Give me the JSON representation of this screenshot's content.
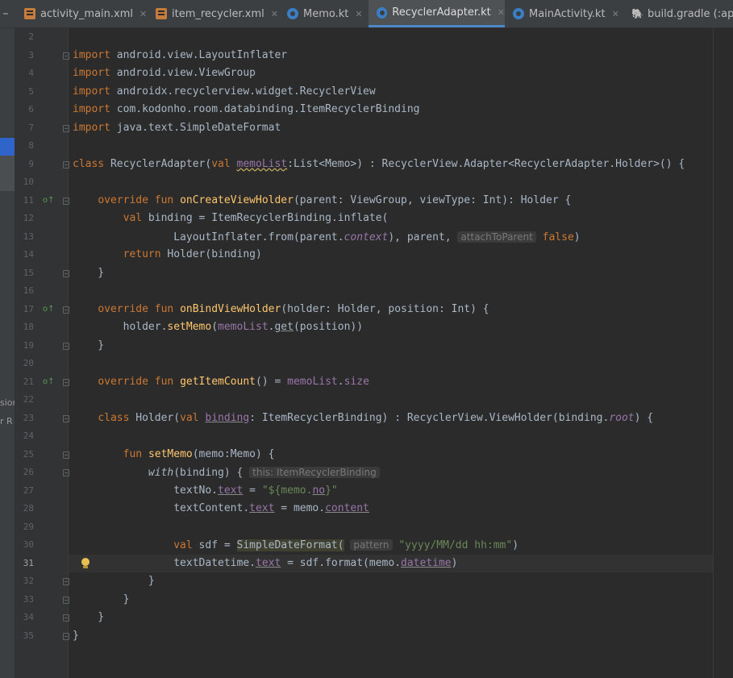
{
  "tabs": [
    {
      "label": "activity_main.xml",
      "icon": "xml-file-icon",
      "active": false
    },
    {
      "label": "item_recycler.xml",
      "icon": "xml-file-icon",
      "active": false
    },
    {
      "label": "Memo.kt",
      "icon": "kotlin-file-icon",
      "active": false
    },
    {
      "label": "RecyclerAdapter.kt",
      "icon": "kotlin-file-icon",
      "active": true
    },
    {
      "label": "MainActivity.kt",
      "icon": "kotlin-file-icon",
      "active": false
    },
    {
      "label": "build.gradle (:app",
      "icon": "gradle-file-icon",
      "active": false
    }
  ],
  "left_panel_fragments": [
    "sior",
    "r R"
  ],
  "colors": {
    "background": "#2b2b2b",
    "gutter": "#313335",
    "keyword": "#cc7832",
    "function": "#ffc66d",
    "string": "#6a8759",
    "property": "#9876aa",
    "text": "#a9b7c6",
    "accent": "#4a88c7"
  },
  "editor": {
    "current_line": 31,
    "lines": [
      {
        "n": "2",
        "t": ""
      },
      {
        "n": "3",
        "t": "import android.view.LayoutInflater"
      },
      {
        "n": "4",
        "t": "import android.view.ViewGroup"
      },
      {
        "n": "5",
        "t": "import androidx.recyclerview.widget.RecyclerView"
      },
      {
        "n": "6",
        "t": "import com.kodonho.room.databinding.ItemRecyclerBinding"
      },
      {
        "n": "7",
        "t": "import java.text.SimpleDateFormat"
      },
      {
        "n": "8",
        "t": ""
      },
      {
        "n": "9",
        "t": "class RecyclerAdapter(val memoList:List<Memo>) : RecyclerView.Adapter<RecyclerAdapter.Holder>() {"
      },
      {
        "n": "10",
        "t": ""
      },
      {
        "n": "11",
        "t": "    override fun onCreateViewHolder(parent: ViewGroup, viewType: Int): Holder {"
      },
      {
        "n": "12",
        "t": "        val binding = ItemRecyclerBinding.inflate("
      },
      {
        "n": "13",
        "t": "                LayoutInflater.from(parent.context), parent, attachToParent false)"
      },
      {
        "n": "14",
        "t": "        return Holder(binding)"
      },
      {
        "n": "15",
        "t": "    }"
      },
      {
        "n": "16",
        "t": ""
      },
      {
        "n": "17",
        "t": "    override fun onBindViewHolder(holder: Holder, position: Int) {"
      },
      {
        "n": "18",
        "t": "        holder.setMemo(memoList.get(position))"
      },
      {
        "n": "19",
        "t": "    }"
      },
      {
        "n": "20",
        "t": ""
      },
      {
        "n": "21",
        "t": "    override fun getItemCount() = memoList.size"
      },
      {
        "n": "22",
        "t": ""
      },
      {
        "n": "23",
        "t": "    class Holder(val binding: ItemRecyclerBinding) : RecyclerView.ViewHolder(binding.root) {"
      },
      {
        "n": "24",
        "t": ""
      },
      {
        "n": "25",
        "t": "        fun setMemo(memo:Memo) {"
      },
      {
        "n": "26",
        "t": "            with(binding) { this: ItemRecyclerBinding"
      },
      {
        "n": "27",
        "t": "                textNo.text = \"${memo.no}\""
      },
      {
        "n": "28",
        "t": "                textContent.text = memo.content"
      },
      {
        "n": "29",
        "t": ""
      },
      {
        "n": "30",
        "t": "                val sdf = SimpleDateFormat( pattern \"yyyy/MM/dd hh:mm\")"
      },
      {
        "n": "31",
        "t": "                textDatetime.text = sdf.format(memo.datetime)"
      },
      {
        "n": "32",
        "t": "            }"
      },
      {
        "n": "33",
        "t": "        }"
      },
      {
        "n": "34",
        "t": "    }"
      },
      {
        "n": "35",
        "t": "}"
      }
    ]
  }
}
